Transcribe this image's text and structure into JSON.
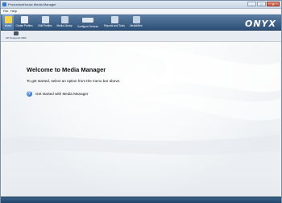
{
  "window": {
    "title": "ProductionHouse Media Manager",
    "controls": [
      "-",
      "□",
      "✕"
    ]
  },
  "menu": {
    "items": [
      "File",
      "Help"
    ]
  },
  "toolbar": {
    "items": [
      {
        "label": "Home",
        "icon": "home-icon",
        "color": "#f7d34a"
      },
      {
        "label": "Create Profiles",
        "icon": "create-profiles-icon",
        "color": "#e9eef5"
      },
      {
        "label": "Edit Profiles",
        "icon": "edit-profiles-icon",
        "color": "#d9e3ef"
      },
      {
        "label": "Media Library",
        "icon": "media-library-icon",
        "color": "#c9d6e5"
      },
      {
        "label": "Configure Devices",
        "icon": "configure-devices-icon",
        "color": "#dfe6ee"
      },
      {
        "label": "Reports and Tools",
        "icon": "reports-tools-icon",
        "color": "#d1dce8"
      },
      {
        "label": "MediaWeb",
        "icon": "media-web-icon",
        "color": "#c3d3e6"
      }
    ],
    "logo": "ONYX"
  },
  "printer": {
    "label": "HP DesignJet 9000",
    "icon": "printer-icon"
  },
  "content": {
    "title": "Welcome to Media Manager",
    "intro": "To get started, select an option from the menu bar above.",
    "help_link": "Get started with Media Manager",
    "help_icon": "question-icon"
  }
}
